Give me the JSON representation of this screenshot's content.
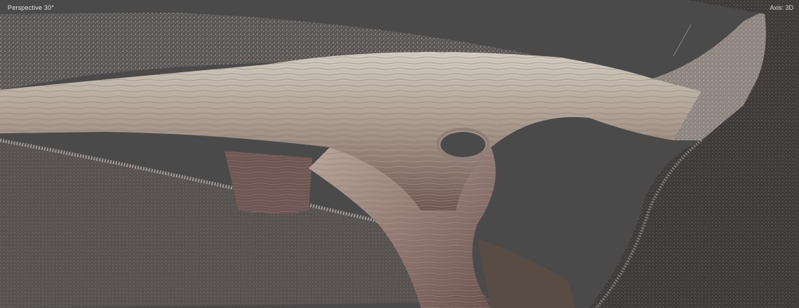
{
  "viewport": {
    "view_label": "Perspective 30°",
    "status_label": "Axis: 3D"
  },
  "colors": {
    "background": "#4a4a4a",
    "wood_light": "#c9c1b6",
    "wood_mid": "#9a8c82",
    "wood_dark": "#6f5a55",
    "points_light": "#d6d3cf",
    "points_dark": "#3a3838"
  }
}
